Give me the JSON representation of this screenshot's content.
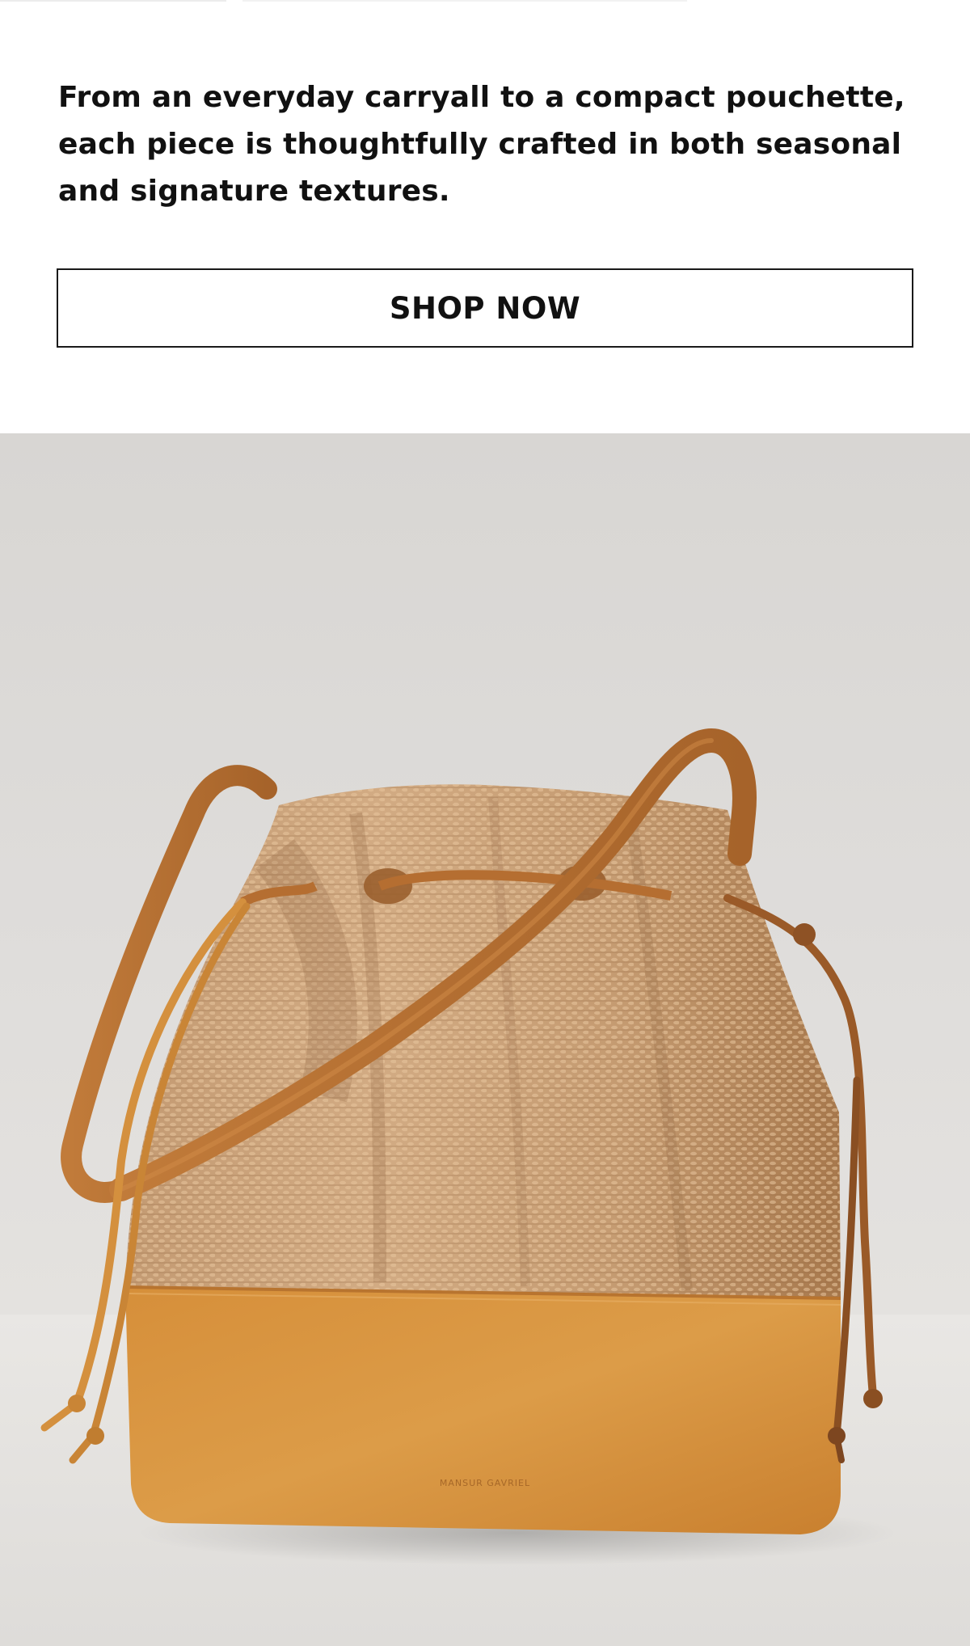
{
  "promo": {
    "description": "From an everyday carryall to a compact pouchette, each piece is thoughtfully crafted in both seasonal and signature textures.",
    "cta_label": "SHOP NOW"
  },
  "hero_image": {
    "subject": "bucket-bag-photo",
    "brand_stamp": "MANSUR GAVRIEL",
    "colors": {
      "backdrop": "#dedcd9",
      "table": "#e8e6e3",
      "raffia": "#c9a078",
      "suede": "#d9963f",
      "strap": "#b8733a"
    }
  }
}
